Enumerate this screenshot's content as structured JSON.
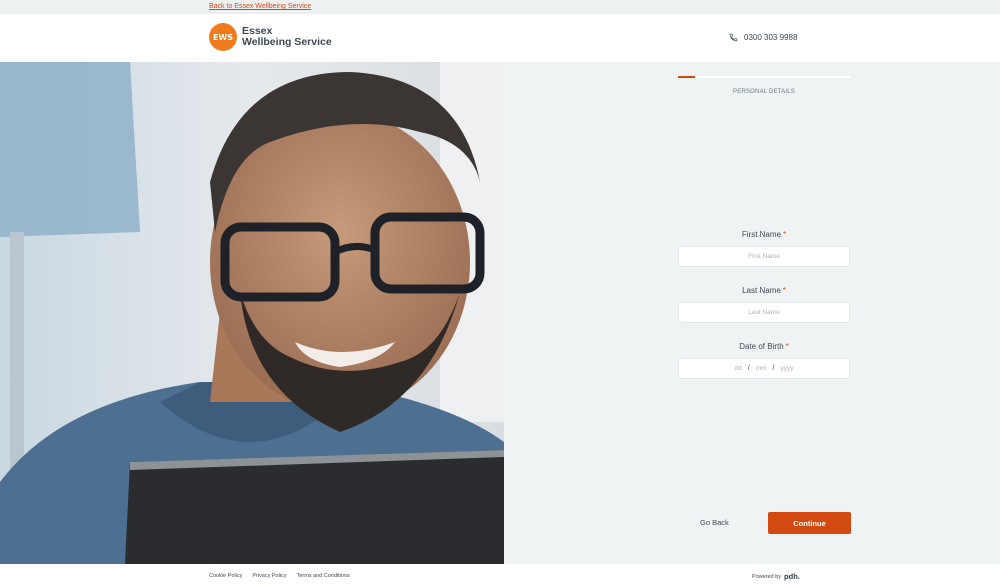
{
  "topbar": {
    "back_link": "Back to Essex Wellbeing Service"
  },
  "header": {
    "logo_badge": "EWS",
    "logo_line1": "Essex",
    "logo_line2": "Wellbeing Service",
    "phone": "0300 303 9988"
  },
  "photo": {
    "description_icon": "smiling-man-with-laptop-photo"
  },
  "form": {
    "progress": 0.1,
    "step_label": "PERSONAL DETAILS",
    "first_name": {
      "label": "First Name",
      "required": "*",
      "placeholder": "First Name",
      "value": ""
    },
    "last_name": {
      "label": "Last Name",
      "required": "*",
      "placeholder": "Last Name",
      "value": ""
    },
    "dob": {
      "label": "Date of Birth",
      "required": "*",
      "day": "dd",
      "month": "mm",
      "year": "yyyy",
      "sep": "/"
    },
    "go_back": "Go Back",
    "continue": "Continue"
  },
  "footer": {
    "links": [
      "Cookie Policy",
      "Privacy Policy",
      "Terms and Conditions"
    ],
    "powered_by": "Powered by",
    "powered_brand": "pdh."
  },
  "colors": {
    "accent": "#d24a12",
    "logo": "#f07b1d",
    "background": "#f0f3f4"
  }
}
